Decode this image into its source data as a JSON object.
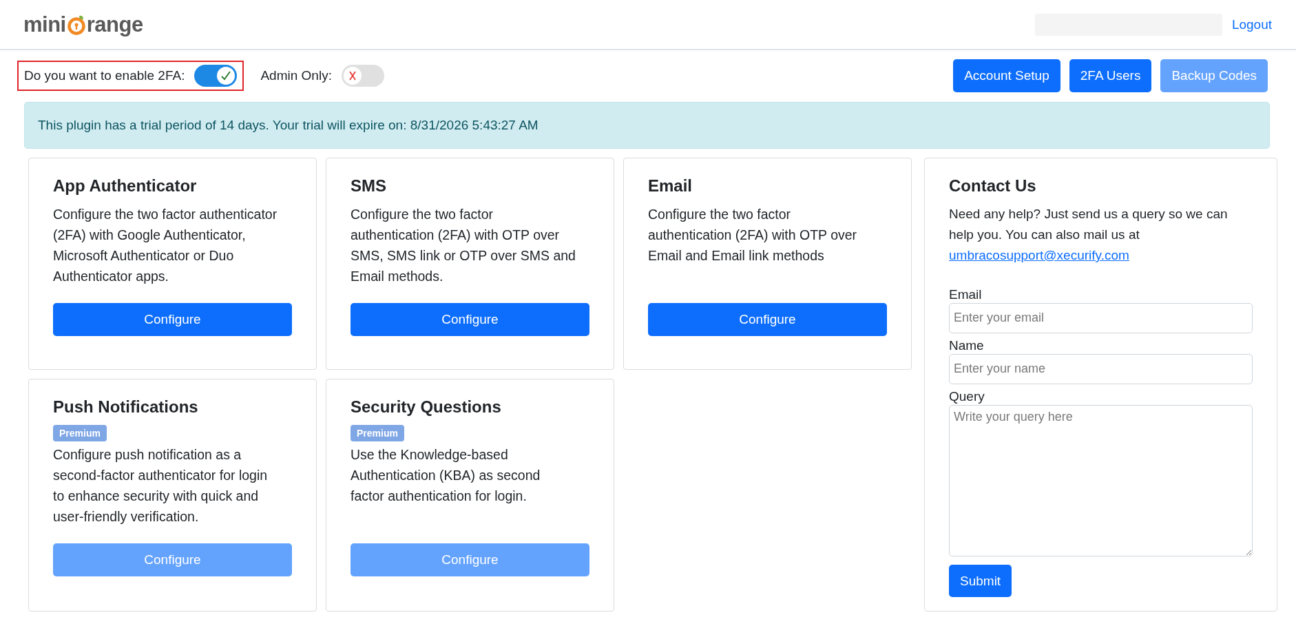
{
  "header": {
    "logo": {
      "prefix": "mini",
      "suffix": "range"
    },
    "logout": "Logout"
  },
  "toolbar": {
    "toggles": [
      {
        "label": "Do you want to enable 2FA:",
        "on": true,
        "highlighted": true
      },
      {
        "label": "Admin Only:",
        "on": false,
        "highlighted": false
      }
    ],
    "buttons": [
      {
        "label": "Account Setup",
        "disabled": false
      },
      {
        "label": "2FA Users",
        "disabled": false
      },
      {
        "label": "Backup Codes",
        "disabled": true
      }
    ]
  },
  "alert": "This plugin has a trial period of 14 days. Your trial will expire on: 8/31/2026 5:43:27 AM",
  "methods": [
    {
      "title": "App Authenticator",
      "description": "Configure the two factor authenticator (2FA) with Google Authenticator, Microsoft Authenticator or Duo Authenticator apps.",
      "button": "Configure",
      "disabled": false
    },
    {
      "title": "SMS",
      "description": "Configure the two factor authentication (2FA) with OTP over SMS, SMS link or OTP over SMS and Email methods.",
      "button": "Configure",
      "disabled": false
    },
    {
      "title": "Email",
      "description": "Configure the two factor authentication (2FA) with OTP over Email and Email link methods",
      "button": "Configure",
      "disabled": false
    },
    {
      "title": "Push Notifications",
      "badge": "Premium",
      "description": "Configure push notification as a second-factor authenticator for login to enhance security with quick and user-friendly verification.",
      "button": "Configure",
      "disabled": true
    },
    {
      "title": "Security Questions",
      "badge": "Premium",
      "description": "Use the Knowledge-based Authentication (KBA) as second factor authentication for login.",
      "button": "Configure",
      "disabled": true
    }
  ],
  "contact": {
    "title": "Contact Us",
    "intro": "Need any help? Just send us a query so we can help you. You can also mail us at",
    "email_link": "umbracosupport@xecurify.com",
    "fields": [
      {
        "label": "Email",
        "placeholder": "Enter your email",
        "kind": "input"
      },
      {
        "label": "Name",
        "placeholder": "Enter your name",
        "kind": "input"
      },
      {
        "label": "Query",
        "placeholder": "Write your query here",
        "kind": "textarea"
      }
    ],
    "submit": "Submit"
  }
}
